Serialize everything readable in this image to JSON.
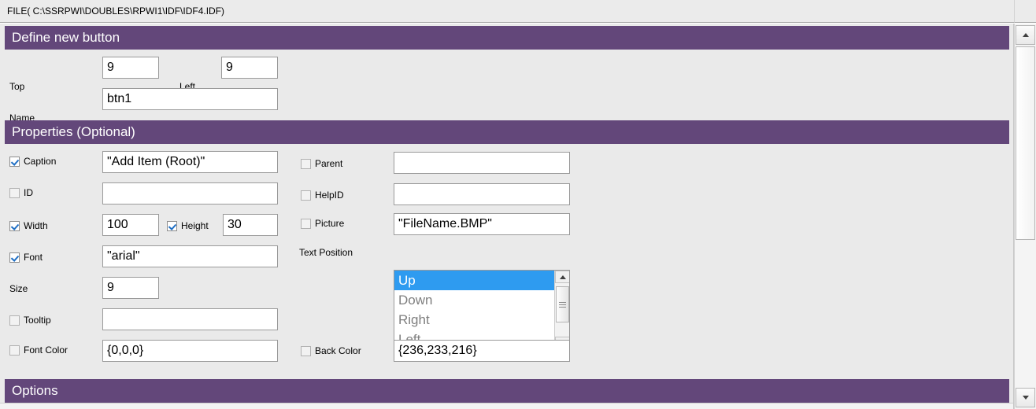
{
  "filebar": {
    "text": "FILE( C:\\SSRPWI\\DOUBLES\\RPWI1\\IDF\\IDF4.IDF)"
  },
  "sections": {
    "define": {
      "title": "Define new button"
    },
    "properties": {
      "title": "Properties (Optional)"
    },
    "options": {
      "title": "Options"
    }
  },
  "define_fields": {
    "top": {
      "label": "Top",
      "value": "9"
    },
    "left": {
      "label": "Left",
      "value": "9"
    },
    "name": {
      "label": "Name",
      "value": "btn1"
    }
  },
  "properties": {
    "caption": {
      "label": "Caption",
      "checked": true,
      "value": "\"Add Item (Root)\""
    },
    "id": {
      "label": "ID",
      "checked": false,
      "value": ""
    },
    "width": {
      "label": "Width",
      "checked": true,
      "value": "100"
    },
    "height": {
      "label": "Height",
      "checked": true,
      "value": "30"
    },
    "font": {
      "label": "Font",
      "checked": true,
      "value": "\"arial\""
    },
    "size": {
      "label": "Size",
      "value": "9"
    },
    "tooltip": {
      "label": "Tooltip",
      "checked": false,
      "value": ""
    },
    "font_color": {
      "label": "Font Color",
      "checked": false,
      "value": "{0,0,0}"
    },
    "parent": {
      "label": "Parent",
      "checked": false,
      "value": ""
    },
    "help_id": {
      "label": "HelpID",
      "checked": false,
      "value": ""
    },
    "picture": {
      "label": "Picture",
      "checked": false,
      "value": "\"FileName.BMP\""
    },
    "back_color": {
      "label": "Back Color",
      "checked": false,
      "value": "{236,233,216}"
    },
    "text_position": {
      "label": "Text Position",
      "selected": "Up",
      "options": [
        "Up",
        "Down",
        "Right",
        "Left"
      ]
    }
  },
  "colors": {
    "section_purple": "#63477a",
    "selection_blue": "#2e9bf0",
    "panel_background": "#eaeaea",
    "checkmark_blue": "#1f6fc4"
  }
}
